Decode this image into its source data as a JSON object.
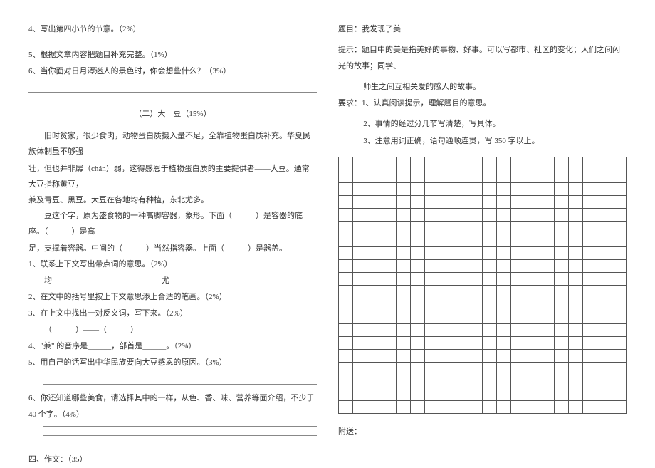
{
  "left": {
    "q4": "4、写出第四小节的节意。（2%）",
    "q5": "5、根据文章内容把题目补充完整。（1%）",
    "q6": "6、当你面对日月潭迷人的景色时，你会想些什么？（3%）",
    "passage2_title": "（二）大　豆（15%）",
    "p1": "旧时贫家，很少食肉，动物蛋白质摄入量不足，全靠植物蛋白质补充。华夏民族体制虽不够强",
    "p2_prefix": "壮，但也并非孱（chán）弱，这得感恩于植物蛋白质的主要提供者——大豆。通常大豆指称黄豆，",
    "p3": "兼及青豆、黑豆。大豆在各地均有种植，东北尤多。",
    "p4": "豆这个字，原为盛食物的一种高脚容器，象形。下面（　　　）是容器的底座。（　　　）是高",
    "p5": "足，支撑着容器。中间的（　　　）当然指容器。上面（　　　）是器盖。",
    "bq1": "1、联系上下文写出带点词的意思。（2%）",
    "bq1_line": "均——　　　　　　　　　　　　尤——",
    "bq2": "2、在文中的括号里按上下文意思添上合适的笔画。（2%）",
    "bq3": "3、在上文中找出一对反义词，写下来。（2%）",
    "bq3_line": "（　　　）——（　　　）",
    "bq4": "4、\"兼\" 的音序是______，部首是______。（2%）",
    "bq5": "5、用自己的话写出中华民族要向大豆感恩的原因。（3%）",
    "bq6": "6、你还知道哪些美食，请选择其中的一样，从色、香、味、营养等面介绍，不少于 40 个字。（4%）",
    "section4": "四、作文：（35）"
  },
  "right": {
    "essay_title": "题目：我发现了美",
    "tip_label": "提示：",
    "tip_text": "题目中的美是指美好的事物、好事。可以写都市、社区的变化；人们之间闪光的故事；同学、",
    "tip_text2": "师生之间互相关爱的感人的故事。",
    "req_label": "要求：",
    "req1": "1、认真阅读提示，理解题目的意思。",
    "req2": "2、事情的经过分几节写清楚，写具体。",
    "req3": "3、注意用词正确，语句通顺连贯，写 350 字以上。",
    "attach": "附送："
  },
  "grid": {
    "rows": 20,
    "cols": 20
  }
}
